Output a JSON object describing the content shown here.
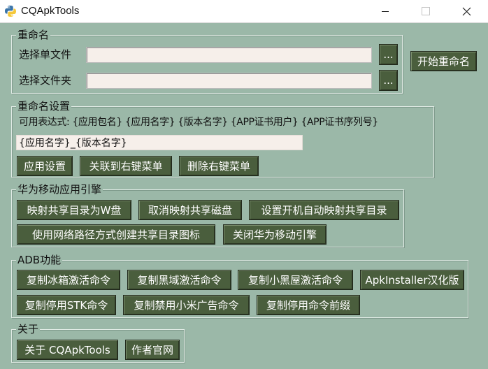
{
  "window": {
    "title": "CQApkTools",
    "icon": "python-icon",
    "controls": [
      "minimize-icon",
      "maximize-icon",
      "close-icon"
    ]
  },
  "rename": {
    "group_title": "重命名",
    "single_file_label": "选择单文件",
    "single_file_value": "",
    "folder_label": "选择文件夹",
    "folder_value": "",
    "browse_label": "...",
    "start_label": "开始重命名"
  },
  "rename_settings": {
    "group_title": "重命名设置",
    "expr_hint": "可用表达式: {应用包名} {应用名字} {版本名字} {APP证书用户} {APP证书序列号}",
    "pattern_value": "{应用名字}_{版本名字}",
    "apply_label": "应用设置",
    "assoc_label": "关联到右键菜单",
    "remove_label": "删除右键菜单"
  },
  "huawei": {
    "group_title": "华为移动应用引擎",
    "buttons": [
      "映射共享目录为W盘",
      "取消映射共享磁盘",
      "设置开机自动映射共享目录",
      "使用网络路径方式创建共享目录图标",
      "关闭华为移动引擎"
    ]
  },
  "adb": {
    "group_title": "ADB功能",
    "buttons": [
      "复制冰箱激活命令",
      "复制黑域激活命令",
      "复制小黑屋激活命令",
      "ApkInstaller汉化版",
      "复制停用STK命令",
      "复制禁用小米广告命令",
      "复制停用命令前缀"
    ]
  },
  "about": {
    "group_title": "关于",
    "buttons": [
      "关于 CQApkTools",
      "作者官网"
    ]
  },
  "colors": {
    "background": "#9bb8a8",
    "button_bg": "#4a5e3d",
    "button_text": "#ffffff",
    "entry_bg": "#f6efea"
  }
}
